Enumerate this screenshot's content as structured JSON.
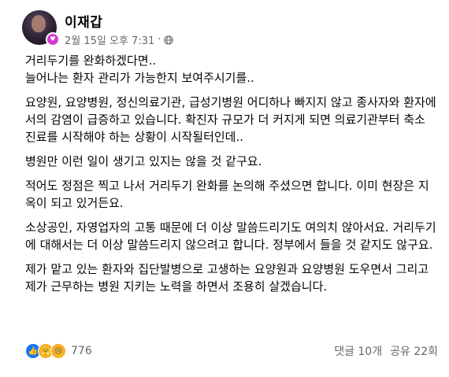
{
  "post": {
    "author": "이재갑",
    "timestamp": "2월 15일 오후 7:31",
    "separator": "·",
    "privacy_icon": "globe-icon",
    "more_icon": "more-options-icon",
    "paragraphs": [
      "거리두기를 완화하겠다면..\n늘어나는 환자 관리가 가능한지 보여주시기를..",
      "요양원, 요양병원, 정신의료기관, 급성기병원 어디하나 빠지지 않고 종사자와 환자에서의 감염이 급증하고 있습니다.  확진자 규모가 더 커지게 되면 의료기관부터 축소 진료를 시작해야 하는 상황이 시작될터인데..",
      "병원만 이런 일이 생기고 있지는 않을 것 같구요.",
      "적어도 정점은 찍고 나서 거리두기 완화를 논의해 주셨으면 합니다. 이미 현장은 지옥이 되고 있거든요.",
      "소상공인, 자영업자의 고통 때문에 더 이상 말씀드리기도 여의치 않아서요. 거리두기에 대해서는 더 이상 말씀드리지 않으려고 합니다. 정부에서 들을 것 같지도 않구요.",
      "제가 맡고 있는 환자와 집단발병으로 고생하는 요양원과 요양병원 도우면서 그리고 제가 근무하는 병원 지키는 노력을 하면서 조용히 살겠습니다."
    ]
  },
  "footer": {
    "reactions": [
      "like-icon",
      "care-icon",
      "sad-icon"
    ],
    "reaction_count": "776",
    "comments": "댓글 10개",
    "shares": "공유 22회"
  },
  "colors": {
    "text": "#050505",
    "secondary": "#65676b",
    "like_blue": "#1877f2",
    "emoji_yellow": "#f7b125"
  }
}
